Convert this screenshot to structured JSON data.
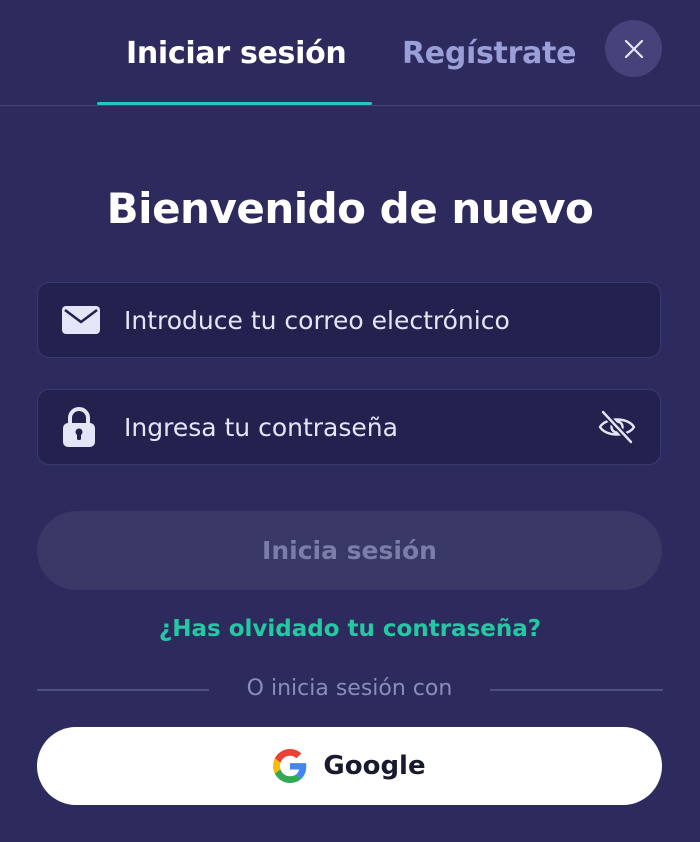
{
  "tabs": {
    "login_label": "Iniciar sesión",
    "register_label": "Regístrate"
  },
  "heading": "Bienvenido de nuevo",
  "email_field": {
    "placeholder": "Introduce tu correo electrónico",
    "value": "",
    "icon": "mail-icon"
  },
  "password_field": {
    "placeholder": "Ingresa tu contraseña",
    "value": "",
    "icon": "lock-icon",
    "toggle_icon": "eye-slash-icon"
  },
  "submit_label": "Inicia sesión",
  "forgot_password": "¿Has olvidado tu contraseña?",
  "divider_text": "O inicia sesión con",
  "google_button": {
    "label": "Google",
    "icon": "google-icon"
  },
  "colors": {
    "background": "#2d2b5e",
    "field_background": "#23224f",
    "accent_teal": "#24c9a3",
    "tab_underline": "#27c7b9",
    "inactive_tab": "#9b9fd8",
    "disabled_button": "#393866"
  }
}
